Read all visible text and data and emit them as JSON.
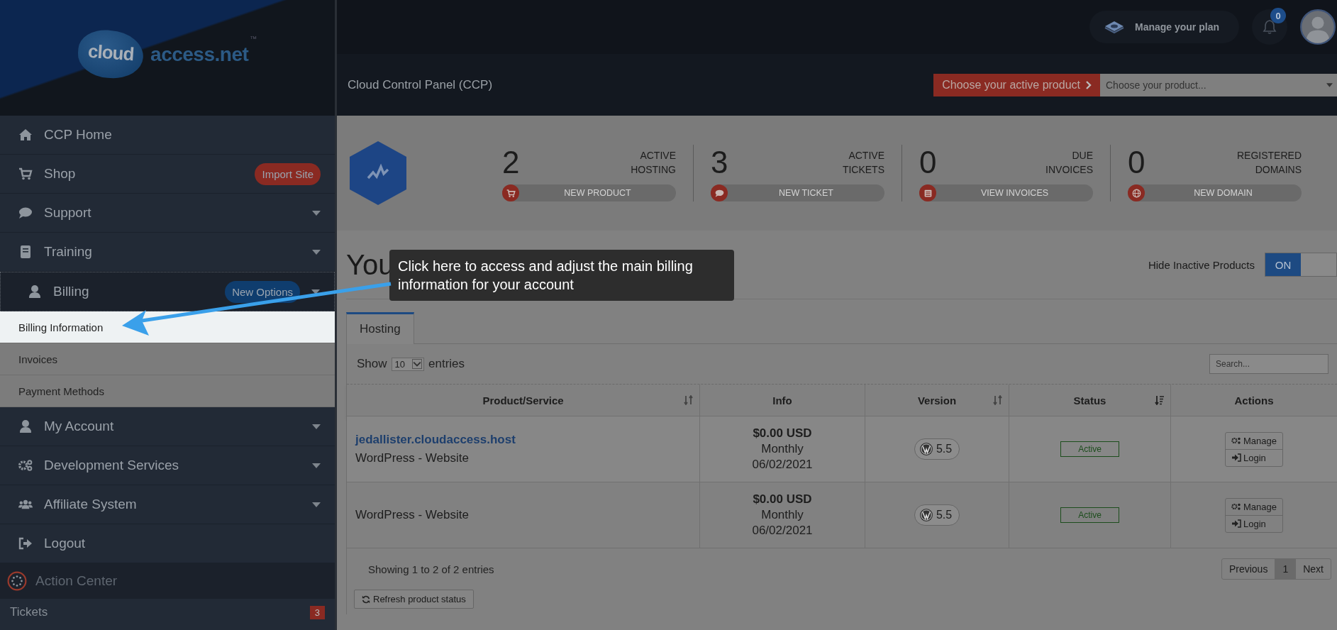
{
  "logo": {
    "badge_text": "cloud",
    "text": "access.net",
    "mark": "™"
  },
  "topbar": {
    "plan_button": "Manage your plan",
    "notifications": "0"
  },
  "subbar": {
    "title": "Cloud Control Panel (CCP)",
    "product_button": "Choose your active product",
    "product_select": {
      "placeholder": "Choose your product..."
    }
  },
  "sidebar": {
    "items": [
      {
        "label": "CCP Home",
        "expandable": false,
        "expanded": false
      },
      {
        "label": "Shop",
        "expandable": false,
        "expanded": false,
        "badge": {
          "label": "Import Site",
          "color": "#8a2a22"
        }
      },
      {
        "label": "Support",
        "expandable": true,
        "expanded": false
      },
      {
        "label": "Training",
        "expandable": true,
        "expanded": false
      },
      {
        "label": "Billing",
        "expandable": true,
        "expanded": true,
        "badge": {
          "label": "New Options",
          "color": "#0f3d6e"
        },
        "children": [
          {
            "label": "Billing Information",
            "selected": true
          },
          {
            "label": "Invoices",
            "selected": false
          },
          {
            "label": "Payment Methods",
            "selected": false
          }
        ]
      },
      {
        "label": "My Account",
        "expandable": true,
        "expanded": false
      },
      {
        "label": "Development Services",
        "expandable": true,
        "expanded": false
      },
      {
        "label": "Affiliate System",
        "expandable": true,
        "expanded": false
      },
      {
        "label": "Logout",
        "expandable": false,
        "expanded": false
      }
    ],
    "action_center": {
      "title": "Action Center",
      "items": [
        {
          "label": "Tickets",
          "count": "3"
        }
      ]
    }
  },
  "stats": [
    {
      "number": "2",
      "label_lines": [
        "ACTIVE",
        "HOSTING"
      ],
      "button": "NEW PRODUCT"
    },
    {
      "number": "3",
      "label_lines": [
        "ACTIVE",
        "TICKETS"
      ],
      "button": "NEW TICKET"
    },
    {
      "number": "0",
      "label_lines": [
        "DUE",
        "INVOICES"
      ],
      "button": "VIEW INVOICES"
    },
    {
      "number": "0",
      "label_lines": [
        "REGISTERED",
        "DOMAINS"
      ],
      "button": "NEW DOMAIN"
    }
  ],
  "products": {
    "heading": "You",
    "hide_inactive": {
      "label": "Hide Inactive Products",
      "toggle": "ON",
      "on": true
    },
    "tabs": [
      {
        "label": "Hosting",
        "selected": true
      }
    ],
    "length_menu": {
      "before": "Show",
      "value": "10",
      "after": "entries"
    },
    "search": {
      "placeholder": "Search..."
    },
    "columns": [
      {
        "label": "Product/Service",
        "sortable": true,
        "sorted": false
      },
      {
        "label": "Info",
        "sortable": false
      },
      {
        "label": "Version",
        "sortable": true,
        "sorted": false
      },
      {
        "label": "Status",
        "sortable": true,
        "sorted": true
      },
      {
        "label": "Actions",
        "sortable": false
      }
    ],
    "rows": [
      {
        "link": "jedallister.cloudaccess.host",
        "type": "WordPress - Website",
        "price": "$0.00 USD",
        "cycle": "Monthly",
        "date": "06/02/2021",
        "version": "5.5",
        "status": "Active",
        "actions": [
          "Manage",
          "Login"
        ]
      },
      {
        "type": "WordPress - Website",
        "price": "$0.00 USD",
        "cycle": "Monthly",
        "date": "06/02/2021",
        "version": "5.5",
        "status": "Active",
        "actions": [
          "Manage",
          "Login"
        ]
      }
    ],
    "info": "Showing 1 to 2 of 2 entries",
    "pagination": [
      {
        "label": "Previous",
        "selected": false
      },
      {
        "label": "1",
        "selected": true
      },
      {
        "label": "Next",
        "selected": false
      }
    ],
    "refresh_button": "Refresh product status"
  },
  "tooltip": {
    "text": "Click here to access and adjust the main billing information for your account"
  }
}
